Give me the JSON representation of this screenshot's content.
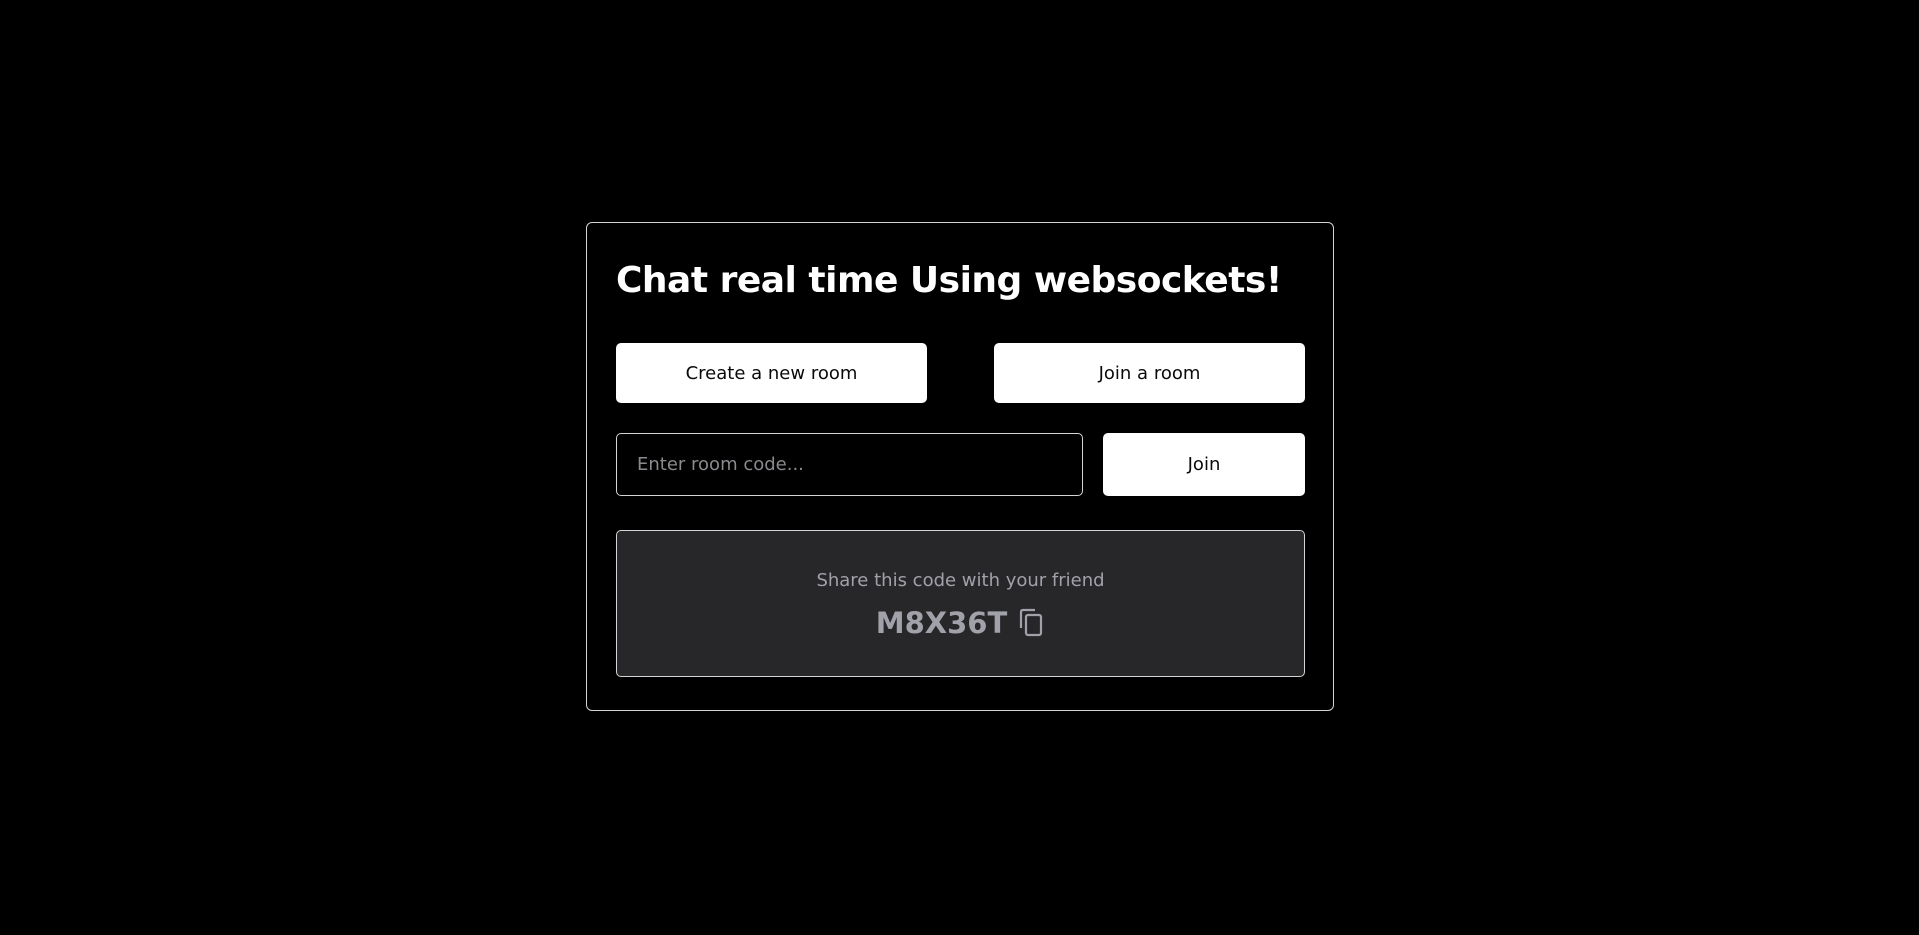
{
  "title": "Chat real time Using websockets!",
  "actions": {
    "create_label": "Create a new room",
    "join_room_label": "Join a room"
  },
  "join_form": {
    "placeholder": "Enter room code...",
    "value": "",
    "join_label": "Join"
  },
  "share": {
    "message": "Share this code with your friend",
    "code": "M8X36T",
    "copy_icon": "copy-icon"
  },
  "colors": {
    "background": "#000000",
    "panel": "#27272a",
    "border": "#d4d4d8",
    "muted_text": "#a1a1aa",
    "button_bg": "#ffffff"
  }
}
